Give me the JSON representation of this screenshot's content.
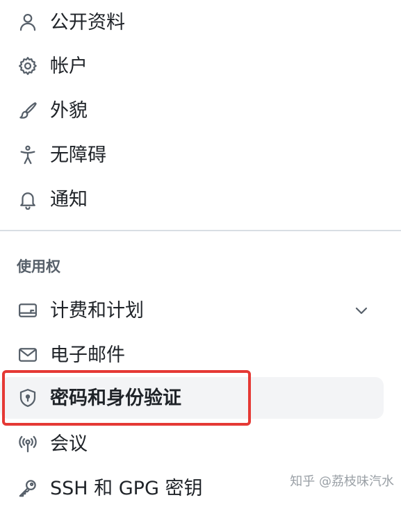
{
  "menu": {
    "items": [
      {
        "label": "公开资料",
        "icon": "person-icon"
      },
      {
        "label": "帐户",
        "icon": "gear-icon"
      },
      {
        "label": "外貌",
        "icon": "paintbrush-icon"
      },
      {
        "label": "无障碍",
        "icon": "accessibility-icon"
      },
      {
        "label": "通知",
        "icon": "bell-icon"
      }
    ],
    "section_heading": "使用权",
    "access_items": [
      {
        "label": "计费和计划",
        "icon": "credit-card-icon",
        "expandable": true
      },
      {
        "label": "电子邮件",
        "icon": "mail-icon"
      },
      {
        "label": "密码和身份验证",
        "icon": "shield-lock-icon",
        "selected": true
      },
      {
        "label": "会议",
        "icon": "broadcast-icon"
      },
      {
        "label": "SSH 和 GPG 密钥",
        "icon": "key-icon"
      }
    ]
  },
  "annotation": {
    "highlight_color": "#e53935"
  },
  "watermark": "知乎 @荔枝味汽水",
  "colors": {
    "selected_bg": "#f3f4f6",
    "icon": "#57606a",
    "text": "#1f2328",
    "divider": "#d8dee4"
  }
}
